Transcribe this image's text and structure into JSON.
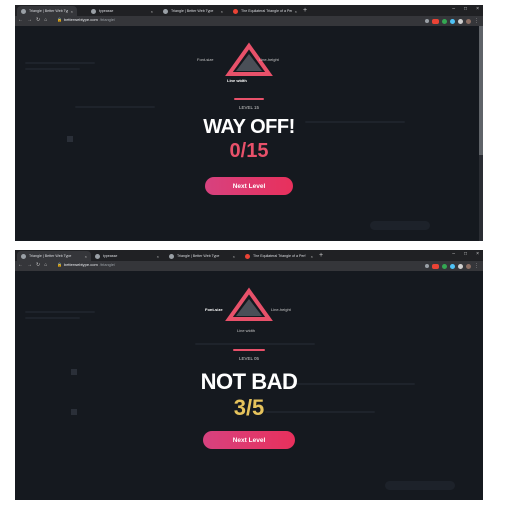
{
  "browser": {
    "tabs": [
      {
        "title": "Triangle | Better Web Type",
        "favicon": "dark-favicon",
        "active": true
      },
      {
        "title": "typeasse",
        "favicon": "gray-favicon",
        "active": false
      },
      {
        "title": "Triangle | Better Web Type",
        "favicon": "dark-favicon",
        "active": false
      },
      {
        "title": "The Equilateral Triangle of a Perf",
        "favicon": "red-favicon",
        "active": false
      }
    ],
    "new_tab": "+",
    "url_host": "betterwebtype.com",
    "url_path": "/triangle/"
  },
  "screens": [
    {
      "level": "LEVEL 15",
      "verdict": "WAY OFF!",
      "score": "0/15",
      "score_color": "#e8516a",
      "button": "Next Level",
      "triangle": {
        "font_size": "Font-size",
        "line_height": "Line-height",
        "line_width": "Line width",
        "bold_label": "line_width"
      }
    },
    {
      "level": "LEVEL 05",
      "verdict": "NOT BAD",
      "score": "3/5",
      "score_color": "#e6c35c",
      "button": "Next Level",
      "triangle": {
        "font_size": "Font-size",
        "line_height": "Line-height",
        "line_width": "Line width",
        "bold_label": "font_size"
      }
    }
  ],
  "colors": {
    "accent": "#e8516a",
    "bg": "#15191f",
    "button_from": "#d7427f",
    "button_to": "#e8305c"
  }
}
